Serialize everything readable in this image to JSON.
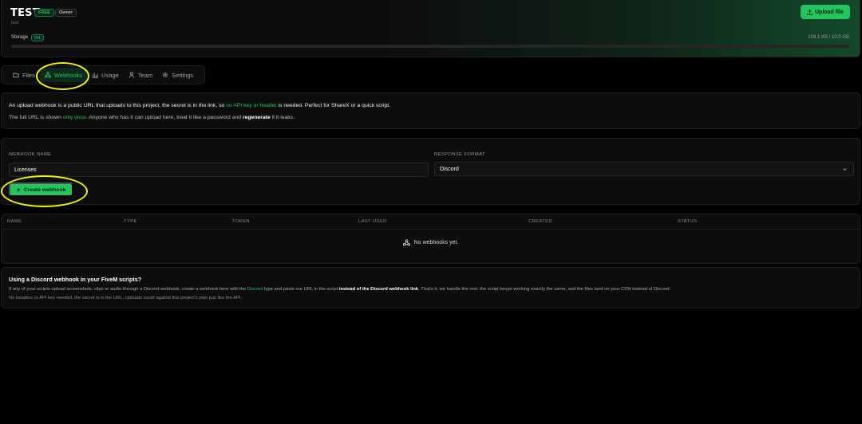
{
  "header": {
    "project_name": "TEST",
    "plan_badge": "FREE",
    "role_badge": "Owner",
    "subtitle": "test",
    "upload_label": "Upload file",
    "storage_label": "Storage",
    "storage_percent": "0%",
    "storage_usage": "109.1 KB / 10.0 GB",
    "storage_fill_fraction": 0.0
  },
  "tabs": [
    {
      "label": "Files",
      "icon": "folder-icon",
      "active": false
    },
    {
      "label": "Webhooks",
      "icon": "webhook-icon",
      "active": true
    },
    {
      "label": "Usage",
      "icon": "bar-chart-icon",
      "active": false
    },
    {
      "label": "Team",
      "icon": "user-icon",
      "active": false
    },
    {
      "label": "Settings",
      "icon": "gear-icon",
      "active": false
    }
  ],
  "info": {
    "l1_a": "An upload webhook is a public URL that uploads to this project, the secret is in the link, so ",
    "l1_green": "no API key or header",
    "l1_b": " is needed. Perfect for ShareX or a quick script.",
    "l2_a": "The full URL is shown ",
    "l2_green": "only once",
    "l2_b": ". Anyone who has it can upload here, treat it like a password and ",
    "l2_bold": "regenerate",
    "l2_c": " if it leaks."
  },
  "form": {
    "name_label": "WEBHOOK NAME",
    "name_value": "Licenses",
    "format_label": "RESPONSE FORMAT",
    "format_value": "Discord",
    "create_label": "Create webhook"
  },
  "table": {
    "columns": [
      "NAME",
      "TYPE",
      "TOKEN",
      "LAST USED",
      "CREATED",
      "STATUS"
    ],
    "empty_text": "No webhooks yet."
  },
  "discord": {
    "title": "Using a Discord webhook in your FiveM scripts?",
    "l1_a": "If any of your scripts upload screenshots, clips or audio through a Discord webhook, create a webhook here with the ",
    "l1_green": "Discord",
    "l1_b": " type and paste our URL in the script ",
    "l1_bold": "instead of the Discord webhook link",
    "l1_c": ". That's it, we handle the rest: the script keeps working exactly the same, and the files land on your CDN instead of Discord.",
    "l2": "No headers or API key needed, the secret is in the URL. Uploads count against this project's plan just like the API."
  },
  "colors": {
    "accent": "#22c55e",
    "background": "#000000",
    "panel": "#0d0d0d",
    "annotation": "#f5f500"
  }
}
